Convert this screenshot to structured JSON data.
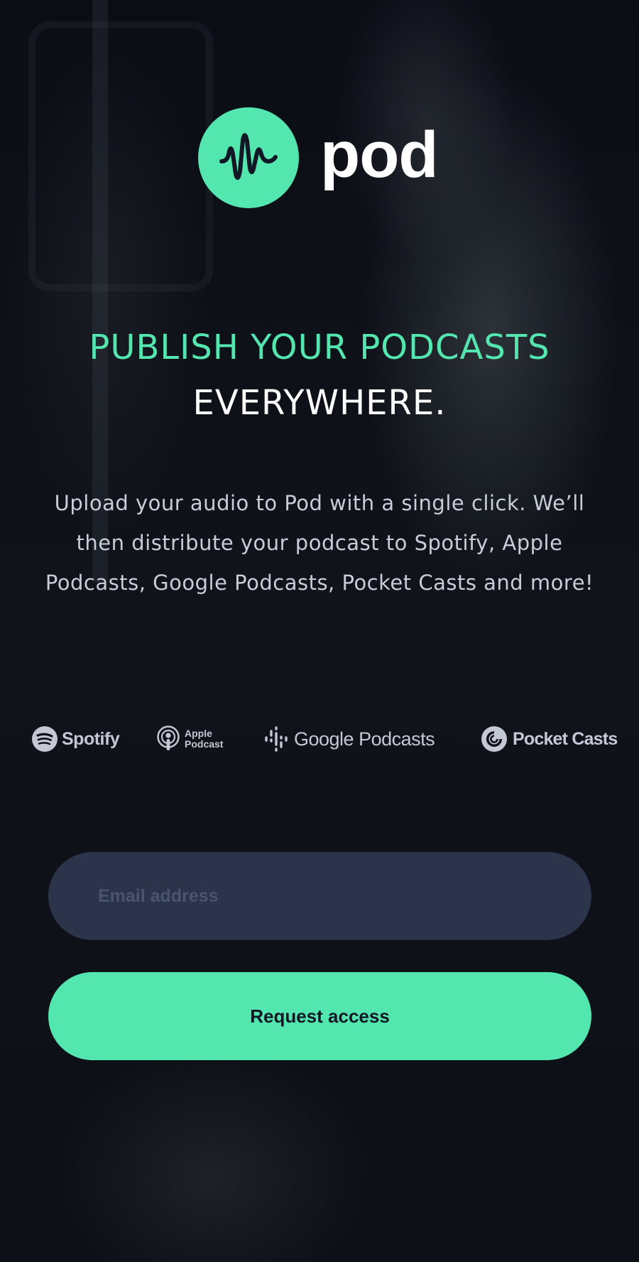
{
  "brand": {
    "name": "pod",
    "accent": "#54e6af",
    "icon": "sound-wave-icon"
  },
  "headline": {
    "line1": "PUBLISH YOUR PODCASTS",
    "line2": "EVERYWHERE."
  },
  "description": "Upload your audio to Pod with a single click. We’ll then distribute your podcast to Spotify, Apple Podcasts, Google Podcasts, Pocket Casts and more!",
  "platforms": [
    {
      "name": "Spotify",
      "icon": "spotify-logo-icon"
    },
    {
      "name": "Apple Podcast",
      "icon": "apple-podcasts-logo-icon"
    },
    {
      "name": "Google Podcasts",
      "icon": "google-podcasts-logo-icon"
    },
    {
      "name": "Pocket Casts",
      "icon": "pocket-casts-logo-icon"
    }
  ],
  "form": {
    "email_placeholder": "Email address",
    "email_value": "",
    "submit_label": "Request access"
  },
  "colors": {
    "background": "#0c0e16",
    "accent": "#54e6af",
    "input_bg": "#2c344c",
    "placeholder": "#4a5470",
    "text_muted": "#c9cdd8"
  }
}
